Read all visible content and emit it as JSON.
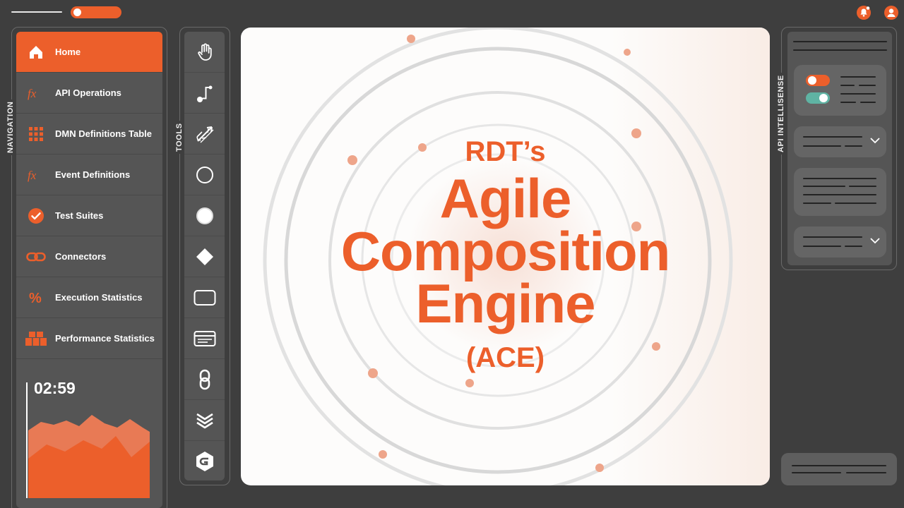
{
  "sidebar": {
    "section_label": "NAVIGATION",
    "items": [
      {
        "label": "Home",
        "icon": "home-icon",
        "active": true
      },
      {
        "label": "API Operations",
        "icon": "function-icon"
      },
      {
        "label": "DMN Definitions Table",
        "icon": "grid-icon"
      },
      {
        "label": "Event Definitions",
        "icon": "function-icon"
      },
      {
        "label": "Test Suites",
        "icon": "check-circle-icon"
      },
      {
        "label": "Connectors",
        "icon": "link-icon"
      },
      {
        "label": "Execution Statistics",
        "icon": "percent-icon"
      },
      {
        "label": "Performance Statistics",
        "icon": "boxes-icon"
      }
    ],
    "timer": "02:59"
  },
  "tools": {
    "section_label": "TOOLS",
    "items": [
      "hand-icon",
      "connector-icon",
      "arrows-icon",
      "circle-outline-icon",
      "circle-filled-icon",
      "diamond-icon",
      "rectangle-icon",
      "form-icon",
      "chain-icon",
      "layers-icon",
      "g-logo-icon"
    ]
  },
  "canvas": {
    "line1": "RDT’s",
    "line2": "Agile",
    "line3": "Composition",
    "line4": "Engine",
    "line5": "(ACE)"
  },
  "api_panel": {
    "section_label": "API INTELLISENSE"
  },
  "colors": {
    "accent": "#ec5f2b",
    "teal": "#5fb3a3",
    "panel": "#555555",
    "background": "#3e3e3e"
  }
}
